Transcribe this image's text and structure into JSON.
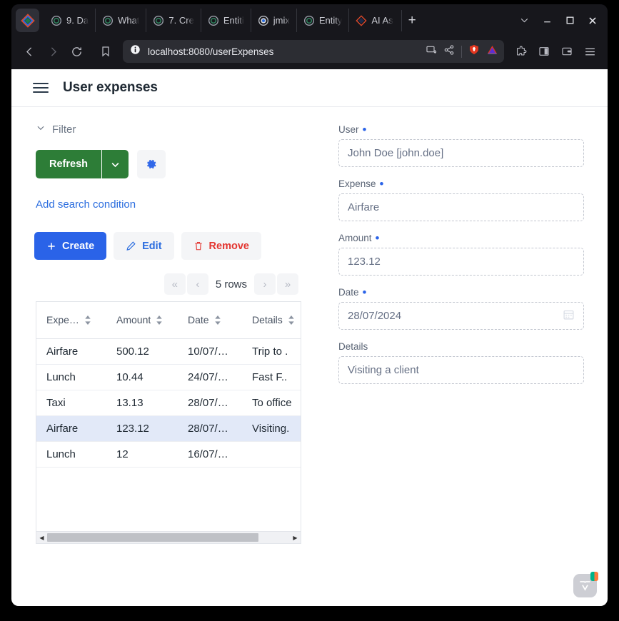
{
  "browser": {
    "tabs": [
      {
        "title": "9. Da",
        "favicon": "ring-icon"
      },
      {
        "title": "What",
        "favicon": "ring-icon"
      },
      {
        "title": "7. Cre",
        "favicon": "ring-icon"
      },
      {
        "title": "Entiti",
        "favicon": "ring-icon"
      },
      {
        "title": "jmix ",
        "favicon": "jmix-icon"
      },
      {
        "title": "Entity",
        "favicon": "ring-icon"
      },
      {
        "title": "AI As",
        "favicon": "diamond-icon"
      }
    ],
    "new_tab_label": "+",
    "window_controls": {
      "tab_search": "⌄",
      "minimize": "—",
      "maximize": "□",
      "close": "✕"
    },
    "nav": {
      "back": "‹",
      "forward": "›",
      "reload": "reload-icon",
      "bookmark": "bookmark-icon"
    },
    "url": "localhost:8080/userExpenses",
    "url_icons": [
      "install-app-icon",
      "share-icon",
      "brave-shields-icon",
      "brave-leo-icon"
    ],
    "toolbar_icons": [
      "extensions-icon",
      "sidebar-icon",
      "wallet-icon",
      "menu-icon"
    ]
  },
  "app": {
    "title": "User expenses",
    "menu_icon": "hamburger-icon",
    "filter": {
      "label": "Filter",
      "collapse_icon": "chevron-down-icon",
      "refresh_label": "Refresh",
      "refresh_dropdown_icon": "chevron-down-icon",
      "settings_icon": "gear-icon",
      "add_condition_label": "Add search condition"
    },
    "actions": {
      "create_label": "Create",
      "create_icon": "plus-icon",
      "edit_label": "Edit",
      "edit_icon": "pencil-icon",
      "remove_label": "Remove",
      "remove_icon": "trash-icon"
    },
    "pager": {
      "first_icon": "«",
      "prev_icon": "‹",
      "rows_label": "5 rows",
      "next_icon": "›",
      "last_icon": "»"
    },
    "grid": {
      "columns": [
        {
          "label": "Expe…",
          "sort_icon": "sort-icon"
        },
        {
          "label": "Amount",
          "sort_icon": "sort-icon"
        },
        {
          "label": "Date",
          "sort_icon": "sort-icon"
        },
        {
          "label": "Details",
          "sort_icon": "sort-icon"
        }
      ],
      "rows": [
        {
          "expense": "Airfare",
          "amount": "500.12",
          "date": "10/07/…",
          "details": "Trip to .",
          "selected": false
        },
        {
          "expense": "Lunch",
          "amount": "10.44",
          "date": "24/07/…",
          "details": "Fast F..",
          "selected": false
        },
        {
          "expense": "Taxi",
          "amount": "13.13",
          "date": "28/07/…",
          "details": "To office",
          "selected": false
        },
        {
          "expense": "Airfare",
          "amount": "123.12",
          "date": "28/07/…",
          "details": "Visiting.",
          "selected": true
        },
        {
          "expense": "Lunch",
          "amount": "12",
          "date": "16/07/…",
          "details": "",
          "selected": false
        }
      ]
    },
    "form": {
      "fields": [
        {
          "label": "User",
          "required": true,
          "value": "John Doe [john.doe]",
          "icon": ""
        },
        {
          "label": "Expense",
          "required": true,
          "value": "Airfare",
          "icon": ""
        },
        {
          "label": "Amount",
          "required": true,
          "value": "123.12",
          "icon": ""
        },
        {
          "label": "Date",
          "required": true,
          "value": "28/07/2024",
          "icon": "calendar-icon"
        },
        {
          "label": "Details",
          "required": false,
          "value": "Visiting a client",
          "icon": ""
        }
      ]
    },
    "vaadin_badge": "vaadin-icon"
  },
  "colors": {
    "brand_green": "#2d7d37",
    "primary_blue": "#2a63e8",
    "link_blue": "#2b6ddf",
    "danger_red": "#e3342f",
    "selected_row": "#e2e9f8",
    "chrome_bg": "#17171c"
  }
}
